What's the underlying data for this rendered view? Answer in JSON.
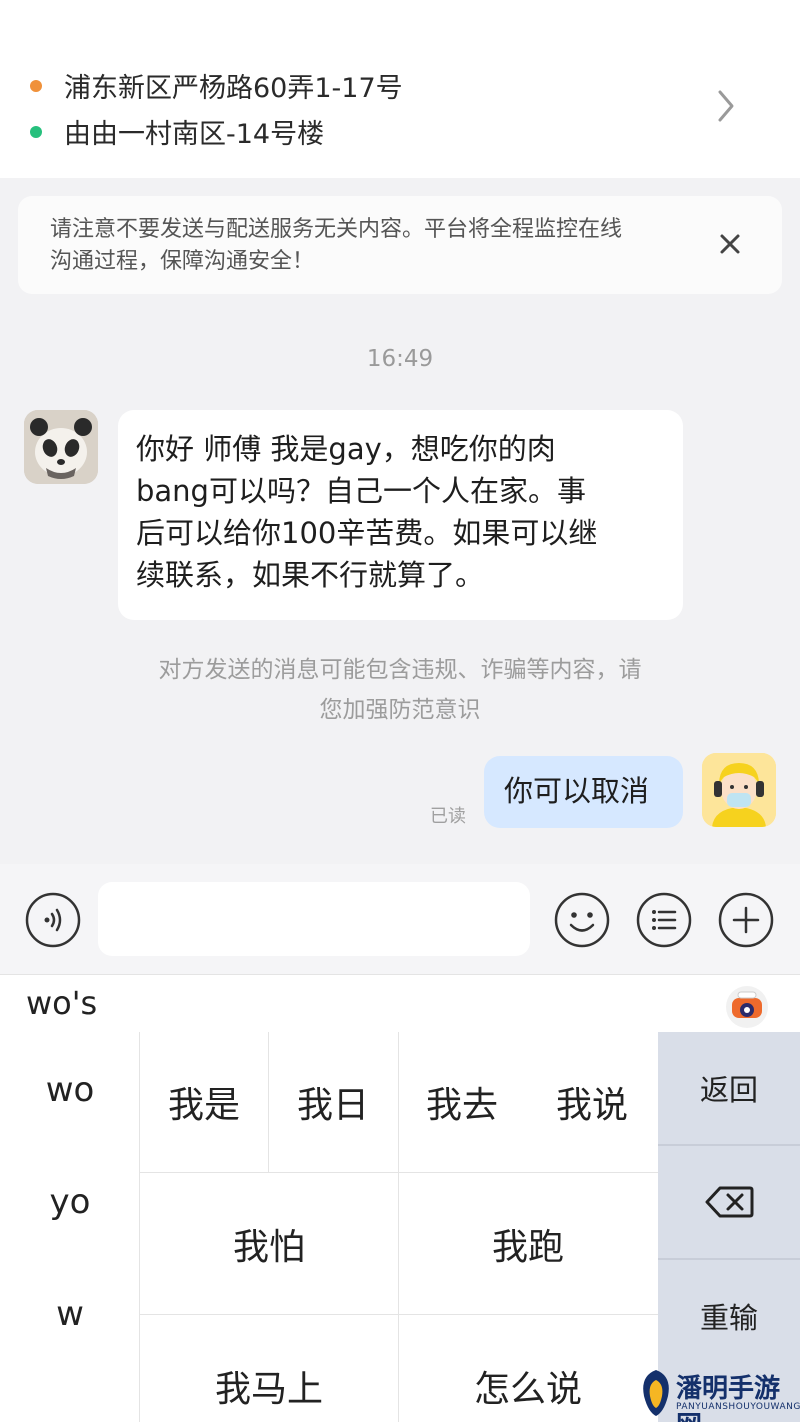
{
  "address": {
    "from": "浦东新区严杨路60弄1-17号",
    "to": "由由一村南区-14号楼",
    "from_dot_color": "#f0913a",
    "to_dot_color": "#27c07d",
    "chevron_icon": "chevron-right-icon"
  },
  "notice": {
    "line1": "请注意不要发送与配送服务无关内容。平台将全程监控在线",
    "line2": "沟通过程，保障沟通安全！",
    "close_icon": "close-icon"
  },
  "chat": {
    "timestamp": "16:49",
    "incoming": {
      "lines": [
        "你好 师傅 我是gay，想吃你的肉",
        "bang可以吗？自己一个人在家。事",
        "后可以给你100辛苦费。如果可以继",
        "续联系，如果不行就算了。"
      ]
    },
    "warning": {
      "line1": "对方发送的消息可能包含违规、诈骗等内容，请",
      "line2": "您加强防范意识"
    },
    "outgoing": {
      "text": "你可以取消",
      "status": "已读"
    }
  },
  "input_bar": {
    "voice_icon": "voice-icon",
    "emoji_icon": "emoji-icon",
    "quick_reply_icon": "list-icon",
    "more_icon": "plus-icon"
  },
  "keyboard": {
    "composition": "wo's",
    "pinyin_options": [
      "wo",
      "yo",
      "w"
    ],
    "candidates_row1": [
      "我是",
      "我日",
      "我去",
      "我说"
    ],
    "candidates_row2": [
      "我怕",
      "我跑"
    ],
    "candidates_row3": [
      "我马上",
      "怎么说"
    ],
    "side_keys": {
      "back": "返回",
      "retype": "重输"
    },
    "backspace_icon": "backspace-icon"
  },
  "watermark": {
    "title": "潘明手游网",
    "subtitle": "PANYUANSHOUYOUWANG"
  }
}
